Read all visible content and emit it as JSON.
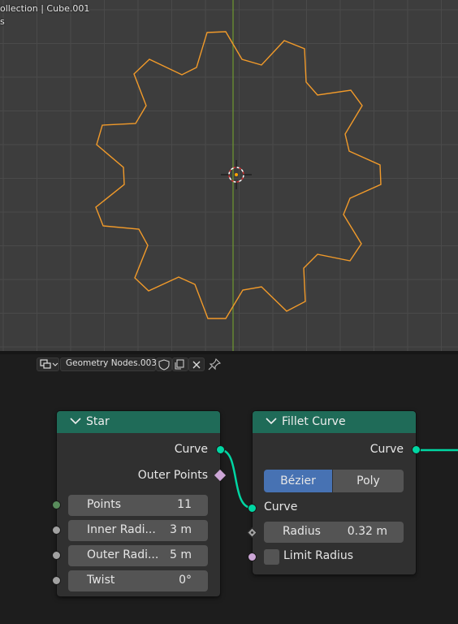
{
  "viewport": {
    "header_line1": "ollection | Cube.001",
    "header_line2": "s",
    "gear_color": "#f19a2a",
    "axis_color": "#6e9a2e",
    "background": "#3d3d3d"
  },
  "node_editor_header": {
    "editor_type_icon": "node-editor-icon",
    "tree_name": "Geometry Nodes.003",
    "icons": [
      "shield-icon",
      "duplicate-icon",
      "close-icon",
      "pin-icon"
    ]
  },
  "nodes": {
    "star": {
      "title": "Star",
      "outputs": [
        "Curve",
        "Outer Points"
      ],
      "inputs": [
        {
          "label": "Points",
          "value": "11"
        },
        {
          "label": "Inner Radi...",
          "value": "3 m"
        },
        {
          "label": "Outer Radi...",
          "value": "5 m"
        },
        {
          "label": "Twist",
          "value": "0°"
        }
      ]
    },
    "fillet": {
      "title": "Fillet Curve",
      "output": "Curve",
      "mode_options": [
        "Bézier",
        "Poly"
      ],
      "mode_selected": "Bézier",
      "input_curve": "Curve",
      "radius": {
        "label": "Radius",
        "value": "0.32 m"
      },
      "limit_radius": {
        "label": "Limit Radius",
        "checked": false
      }
    }
  },
  "colors": {
    "node_header": "#1f6b58",
    "geometry_socket": "#00d6a3",
    "integer_socket": "#598c5c",
    "float_socket": "#a1a1a1",
    "bool_socket": "#cca6d6",
    "selected_button": "#4772b3",
    "link": "#00d6a3"
  }
}
